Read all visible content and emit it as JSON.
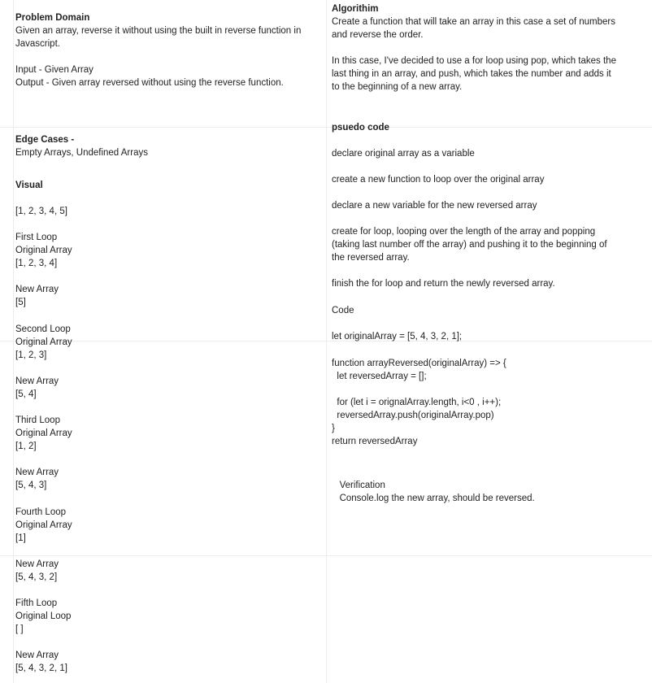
{
  "left": [
    {
      "text": "Problem Domain",
      "bold": true,
      "gap": 0
    },
    {
      "text": "Given an array, reverse it without using the built in reverse function in"
    },
    {
      "text": "Javascript."
    },
    {
      "text": "Input - Given Array",
      "gap": 16
    },
    {
      "text": "Output - Given array reversed without using the reverse function."
    },
    {
      "text": "Edge Cases -",
      "bold": true,
      "gap": 54
    },
    {
      "text": "Empty Arrays, Undefined Arrays"
    },
    {
      "text": "Visual",
      "bold": true,
      "gap": 24
    },
    {
      "text": "[1, 2, 3, 4, 5]",
      "gap": 16
    },
    {
      "text": "First Loop",
      "gap": 16
    },
    {
      "text": "Original Array"
    },
    {
      "text": "[1, 2, 3, 4]"
    },
    {
      "text": "New Array",
      "gap": 16
    },
    {
      "text": "[5]"
    },
    {
      "text": "Second Loop",
      "gap": 17
    },
    {
      "text": "Original Array"
    },
    {
      "text": "[1, 2, 3]"
    },
    {
      "text": "New Array",
      "gap": 16
    },
    {
      "text": "[5, 4]"
    },
    {
      "text": "Third Loop",
      "gap": 16
    },
    {
      "text": "Original Array"
    },
    {
      "text": "[1, 2]"
    },
    {
      "text": "New Array",
      "gap": 16
    },
    {
      "text": "[5, 4, 3]"
    },
    {
      "text": "Fourth Loop",
      "gap": 17
    },
    {
      "text": "Original Array"
    },
    {
      "text": "[1]"
    },
    {
      "text": "New Array",
      "gap": 16
    },
    {
      "text": "[5, 4, 3, 2]"
    },
    {
      "text": "Fifth Loop",
      "gap": 16
    },
    {
      "text": "Original Loop"
    },
    {
      "text": "[ ]"
    },
    {
      "text": "New Array",
      "gap": 16
    },
    {
      "text": "[5, 4, 3, 2, 1]"
    }
  ],
  "right": [
    {
      "text": "Algorithim",
      "bold": true,
      "gap": 0
    },
    {
      "text": "Create a function that will take an array in this case a set of numbers"
    },
    {
      "text": "and reverse the order."
    },
    {
      "text": "In this case, I've decided to use a for loop using pop, which takes the",
      "gap": 16
    },
    {
      "text": "last thing in an array, and push, which takes the number and adds it"
    },
    {
      "text": "to the beginning of a new array."
    },
    {
      "text": "psuedo code",
      "bold": true,
      "gap": 34
    },
    {
      "text": "declare original array as a variable",
      "gap": 16
    },
    {
      "text": "create a new function to loop over the original array",
      "gap": 16
    },
    {
      "text": "declare a new variable for the new reversed array",
      "gap": 16
    },
    {
      "text": "create for loop, looping over the length of the array and popping",
      "gap": 16
    },
    {
      "text": "(taking last number off the array) and pushing it to the beginning of"
    },
    {
      "text": "the reversed array."
    },
    {
      "text": "finish the for loop and return the newly reversed array.",
      "gap": 16
    },
    {
      "text": "Code",
      "gap": 17
    },
    {
      "text": "let originalArray = [5, 4, 3, 2, 1];",
      "gap": 16
    },
    {
      "text": "function arrayReversed(originalArray) => {",
      "gap": 17
    },
    {
      "text": "  let reversedArray = [];"
    },
    {
      "text": "  for (let i = orignalArray.length, i<0 , i++);",
      "gap": 16
    },
    {
      "text": "  reversedArray.push(originalArray.pop)"
    },
    {
      "text": "}"
    },
    {
      "text": "return reversedArray"
    },
    {
      "text": "   Verification",
      "gap": 38
    },
    {
      "text": "   Console.log the new array, should be reversed."
    }
  ]
}
